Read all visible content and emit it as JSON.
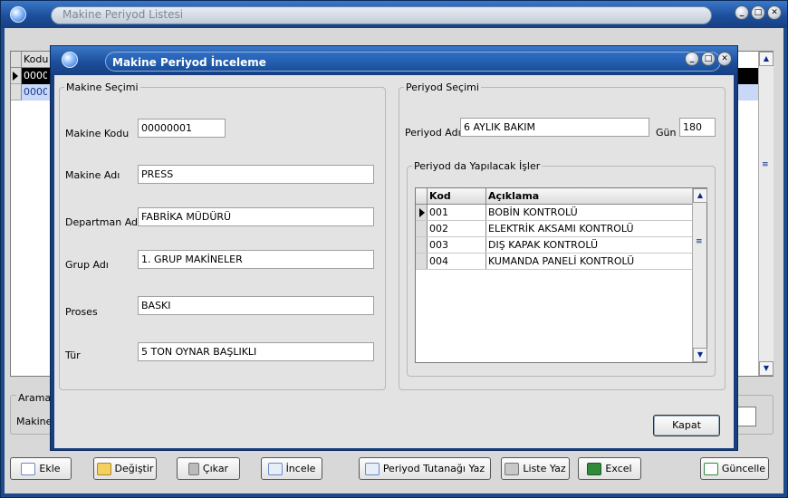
{
  "background_window": {
    "title": "Makine Periyod Listesi",
    "grid_header": "Kodu",
    "rows": [
      "00000",
      "00000"
    ],
    "arama_label": "Arama",
    "makine_label": "Makine"
  },
  "toolbar": {
    "ekle": "Ekle",
    "degistir": "Değiştir",
    "cikar": "Çıkar",
    "incele": "İncele",
    "periyod_tutanagi": "Periyod Tutanağı Yaz",
    "liste_yaz": "Liste Yaz",
    "excel": "Excel",
    "guncelle": "Güncelle"
  },
  "dialog": {
    "title": "Makine Periyod İnceleme",
    "makine_secimi": {
      "group_label": "Makine Seçimi",
      "makine_kodu_label": "Makine Kodu",
      "makine_kodu": "00000001",
      "makine_adi_label": "Makine Adı",
      "makine_adi": "PRESS",
      "departman_adi_label": "Departman Adı",
      "departman_adi": "FABRİKA MÜDÜRÜ",
      "grup_adi_label": "Grup Adı",
      "grup_adi": "1. GRUP MAKİNELER",
      "proses_label": "Proses",
      "proses": "BASKI",
      "tur_label": "Tür",
      "tur": "5 TON OYNAR BAŞLIKLI"
    },
    "periyod_secimi": {
      "group_label": "Periyod Seçimi",
      "periyod_adi_label": "Periyod Adı",
      "periyod_adi": "6 AYLIK BAKIM",
      "gun_label": "Gün",
      "gun": "180",
      "isler_group_label": "Periyod da Yapılacak İşler",
      "columns": [
        "Kod",
        "Açıklama"
      ],
      "rows": [
        {
          "kod": "001",
          "aciklama": "BOBİN KONTROLÜ"
        },
        {
          "kod": "002",
          "aciklama": "ELEKTRİK AKSAMI KONTROLÜ"
        },
        {
          "kod": "003",
          "aciklama": "DIŞ KAPAK KONTROLÜ"
        },
        {
          "kod": "004",
          "aciklama": "KUMANDA PANELİ KONTROLÜ"
        }
      ]
    },
    "kapat": "Kapat"
  },
  "window_controls": {
    "minimize": "_",
    "maximize": "□",
    "close": "✕"
  },
  "colors": {
    "title_blue": "#1c4f9c",
    "client_gray": "#e3e3e3",
    "selection": "#000000"
  }
}
